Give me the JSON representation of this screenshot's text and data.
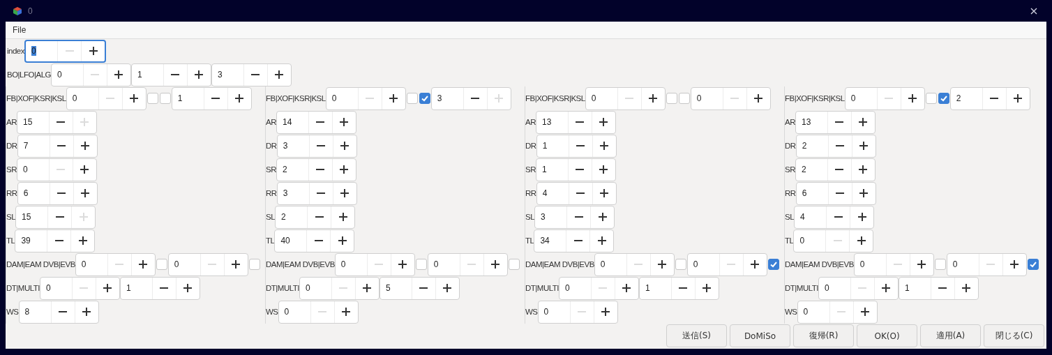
{
  "window": {
    "title": "0"
  },
  "menu": [
    {
      "label": "File"
    }
  ],
  "top_rows": [
    {
      "label": "index",
      "controls": [
        {
          "kind": "spin",
          "value": "0",
          "minus_disabled": true,
          "plus_disabled": false,
          "focused": true
        }
      ]
    },
    {
      "label": "BO|LFO|ALG",
      "controls": [
        {
          "kind": "spin",
          "value": "0",
          "minus_disabled": true,
          "plus_disabled": false
        },
        {
          "kind": "spin",
          "value": "1",
          "minus_disabled": false,
          "plus_disabled": false
        },
        {
          "kind": "spin",
          "value": "3",
          "minus_disabled": false,
          "plus_disabled": false
        }
      ]
    }
  ],
  "operators": [
    {
      "rows": [
        {
          "label": "FB|XOF|KSR|KSL",
          "controls": [
            {
              "kind": "spin",
              "value": "0",
              "minus_disabled": true,
              "plus_disabled": false
            },
            {
              "kind": "checkbox",
              "checked": false
            },
            {
              "kind": "checkbox",
              "checked": false
            },
            {
              "kind": "spin",
              "value": "1",
              "minus_disabled": false,
              "plus_disabled": false
            }
          ]
        },
        {
          "label": "AR",
          "controls": [
            {
              "kind": "spin",
              "value": "15",
              "minus_disabled": false,
              "plus_disabled": true
            }
          ]
        },
        {
          "label": "DR",
          "controls": [
            {
              "kind": "spin",
              "value": "7",
              "minus_disabled": false,
              "plus_disabled": false
            }
          ]
        },
        {
          "label": "SR",
          "controls": [
            {
              "kind": "spin",
              "value": "0",
              "minus_disabled": true,
              "plus_disabled": false
            }
          ]
        },
        {
          "label": "RR",
          "controls": [
            {
              "kind": "spin",
              "value": "6",
              "minus_disabled": false,
              "plus_disabled": false
            }
          ]
        },
        {
          "label": "SL",
          "controls": [
            {
              "kind": "spin",
              "value": "15",
              "minus_disabled": false,
              "plus_disabled": true
            }
          ]
        },
        {
          "label": "TL",
          "controls": [
            {
              "kind": "spin",
              "value": "39",
              "minus_disabled": false,
              "plus_disabled": false
            }
          ]
        },
        {
          "label": "DAM|EAM DVB|EVB",
          "controls": [
            {
              "kind": "spin",
              "value": "0",
              "minus_disabled": true,
              "plus_disabled": false
            },
            {
              "kind": "checkbox",
              "checked": false
            },
            {
              "kind": "spin",
              "value": "0",
              "minus_disabled": true,
              "plus_disabled": false
            },
            {
              "kind": "checkbox",
              "checked": false
            }
          ]
        },
        {
          "label": "DT|MULTI",
          "controls": [
            {
              "kind": "spin",
              "value": "0",
              "minus_disabled": true,
              "plus_disabled": false
            },
            {
              "kind": "spin",
              "value": "1",
              "minus_disabled": false,
              "plus_disabled": false
            }
          ]
        },
        {
          "label": "WS",
          "controls": [
            {
              "kind": "spin",
              "value": "8",
              "minus_disabled": false,
              "plus_disabled": false
            }
          ]
        }
      ]
    },
    {
      "rows": [
        {
          "label": "FB|XOF|KSR|KSL",
          "controls": [
            {
              "kind": "spin",
              "value": "0",
              "minus_disabled": true,
              "plus_disabled": false
            },
            {
              "kind": "checkbox",
              "checked": false
            },
            {
              "kind": "checkbox",
              "checked": true
            },
            {
              "kind": "spin",
              "value": "3",
              "minus_disabled": false,
              "plus_disabled": true
            }
          ]
        },
        {
          "label": "AR",
          "controls": [
            {
              "kind": "spin",
              "value": "14",
              "minus_disabled": false,
              "plus_disabled": false
            }
          ]
        },
        {
          "label": "DR",
          "controls": [
            {
              "kind": "spin",
              "value": "3",
              "minus_disabled": false,
              "plus_disabled": false
            }
          ]
        },
        {
          "label": "SR",
          "controls": [
            {
              "kind": "spin",
              "value": "2",
              "minus_disabled": false,
              "plus_disabled": false
            }
          ]
        },
        {
          "label": "RR",
          "controls": [
            {
              "kind": "spin",
              "value": "3",
              "minus_disabled": false,
              "plus_disabled": false
            }
          ]
        },
        {
          "label": "SL",
          "controls": [
            {
              "kind": "spin",
              "value": "2",
              "minus_disabled": false,
              "plus_disabled": false
            }
          ]
        },
        {
          "label": "TL",
          "controls": [
            {
              "kind": "spin",
              "value": "40",
              "minus_disabled": false,
              "plus_disabled": false
            }
          ]
        },
        {
          "label": "DAM|EAM DVB|EVB",
          "controls": [
            {
              "kind": "spin",
              "value": "0",
              "minus_disabled": true,
              "plus_disabled": false
            },
            {
              "kind": "checkbox",
              "checked": false
            },
            {
              "kind": "spin",
              "value": "0",
              "minus_disabled": true,
              "plus_disabled": false
            },
            {
              "kind": "checkbox",
              "checked": false
            }
          ]
        },
        {
          "label": "DT|MULTI",
          "controls": [
            {
              "kind": "spin",
              "value": "0",
              "minus_disabled": true,
              "plus_disabled": false
            },
            {
              "kind": "spin",
              "value": "5",
              "minus_disabled": false,
              "plus_disabled": false
            }
          ]
        },
        {
          "label": "WS",
          "controls": [
            {
              "kind": "spin",
              "value": "0",
              "minus_disabled": true,
              "plus_disabled": false
            }
          ]
        }
      ]
    },
    {
      "rows": [
        {
          "label": "FB|XOF|KSR|KSL",
          "controls": [
            {
              "kind": "spin",
              "value": "0",
              "minus_disabled": true,
              "plus_disabled": false
            },
            {
              "kind": "checkbox",
              "checked": false
            },
            {
              "kind": "checkbox",
              "checked": false
            },
            {
              "kind": "spin",
              "value": "0",
              "minus_disabled": true,
              "plus_disabled": false
            }
          ]
        },
        {
          "label": "AR",
          "controls": [
            {
              "kind": "spin",
              "value": "13",
              "minus_disabled": false,
              "plus_disabled": false
            }
          ]
        },
        {
          "label": "DR",
          "controls": [
            {
              "kind": "spin",
              "value": "1",
              "minus_disabled": false,
              "plus_disabled": false
            }
          ]
        },
        {
          "label": "SR",
          "controls": [
            {
              "kind": "spin",
              "value": "1",
              "minus_disabled": false,
              "plus_disabled": false
            }
          ]
        },
        {
          "label": "RR",
          "controls": [
            {
              "kind": "spin",
              "value": "4",
              "minus_disabled": false,
              "plus_disabled": false
            }
          ]
        },
        {
          "label": "SL",
          "controls": [
            {
              "kind": "spin",
              "value": "3",
              "minus_disabled": false,
              "plus_disabled": false
            }
          ]
        },
        {
          "label": "TL",
          "controls": [
            {
              "kind": "spin",
              "value": "34",
              "minus_disabled": false,
              "plus_disabled": false
            }
          ]
        },
        {
          "label": "DAM|EAM DVB|EVB",
          "controls": [
            {
              "kind": "spin",
              "value": "0",
              "minus_disabled": true,
              "plus_disabled": false
            },
            {
              "kind": "checkbox",
              "checked": false
            },
            {
              "kind": "spin",
              "value": "0",
              "minus_disabled": true,
              "plus_disabled": false
            },
            {
              "kind": "checkbox",
              "checked": true
            }
          ]
        },
        {
          "label": "DT|MULTI",
          "controls": [
            {
              "kind": "spin",
              "value": "0",
              "minus_disabled": true,
              "plus_disabled": false
            },
            {
              "kind": "spin",
              "value": "1",
              "minus_disabled": false,
              "plus_disabled": false
            }
          ]
        },
        {
          "label": "WS",
          "controls": [
            {
              "kind": "spin",
              "value": "0",
              "minus_disabled": true,
              "plus_disabled": false
            }
          ]
        }
      ]
    },
    {
      "rows": [
        {
          "label": "FB|XOF|KSR|KSL",
          "controls": [
            {
              "kind": "spin",
              "value": "0",
              "minus_disabled": true,
              "plus_disabled": false
            },
            {
              "kind": "checkbox",
              "checked": false
            },
            {
              "kind": "checkbox",
              "checked": true
            },
            {
              "kind": "spin",
              "value": "2",
              "minus_disabled": false,
              "plus_disabled": false
            }
          ]
        },
        {
          "label": "AR",
          "controls": [
            {
              "kind": "spin",
              "value": "13",
              "minus_disabled": false,
              "plus_disabled": false
            }
          ]
        },
        {
          "label": "DR",
          "controls": [
            {
              "kind": "spin",
              "value": "2",
              "minus_disabled": false,
              "plus_disabled": false
            }
          ]
        },
        {
          "label": "SR",
          "controls": [
            {
              "kind": "spin",
              "value": "2",
              "minus_disabled": false,
              "plus_disabled": false
            }
          ]
        },
        {
          "label": "RR",
          "controls": [
            {
              "kind": "spin",
              "value": "6",
              "minus_disabled": false,
              "plus_disabled": false
            }
          ]
        },
        {
          "label": "SL",
          "controls": [
            {
              "kind": "spin",
              "value": "4",
              "minus_disabled": false,
              "plus_disabled": false
            }
          ]
        },
        {
          "label": "TL",
          "controls": [
            {
              "kind": "spin",
              "value": "0",
              "minus_disabled": true,
              "plus_disabled": false
            }
          ]
        },
        {
          "label": "DAM|EAM DVB|EVB",
          "controls": [
            {
              "kind": "spin",
              "value": "0",
              "minus_disabled": true,
              "plus_disabled": false
            },
            {
              "kind": "checkbox",
              "checked": false
            },
            {
              "kind": "spin",
              "value": "0",
              "minus_disabled": true,
              "plus_disabled": false
            },
            {
              "kind": "checkbox",
              "checked": true
            }
          ]
        },
        {
          "label": "DT|MULTI",
          "controls": [
            {
              "kind": "spin",
              "value": "0",
              "minus_disabled": true,
              "plus_disabled": false
            },
            {
              "kind": "spin",
              "value": "1",
              "minus_disabled": false,
              "plus_disabled": false
            }
          ]
        },
        {
          "label": "WS",
          "controls": [
            {
              "kind": "spin",
              "value": "0",
              "minus_disabled": true,
              "plus_disabled": false
            }
          ]
        }
      ]
    }
  ],
  "buttons": [
    {
      "label": "送信(S)"
    },
    {
      "label": "DoMiSo"
    },
    {
      "label": "復帰(R)"
    },
    {
      "label": "OK(O)"
    },
    {
      "label": "適用(A)"
    },
    {
      "label": "閉じる(C)"
    }
  ]
}
